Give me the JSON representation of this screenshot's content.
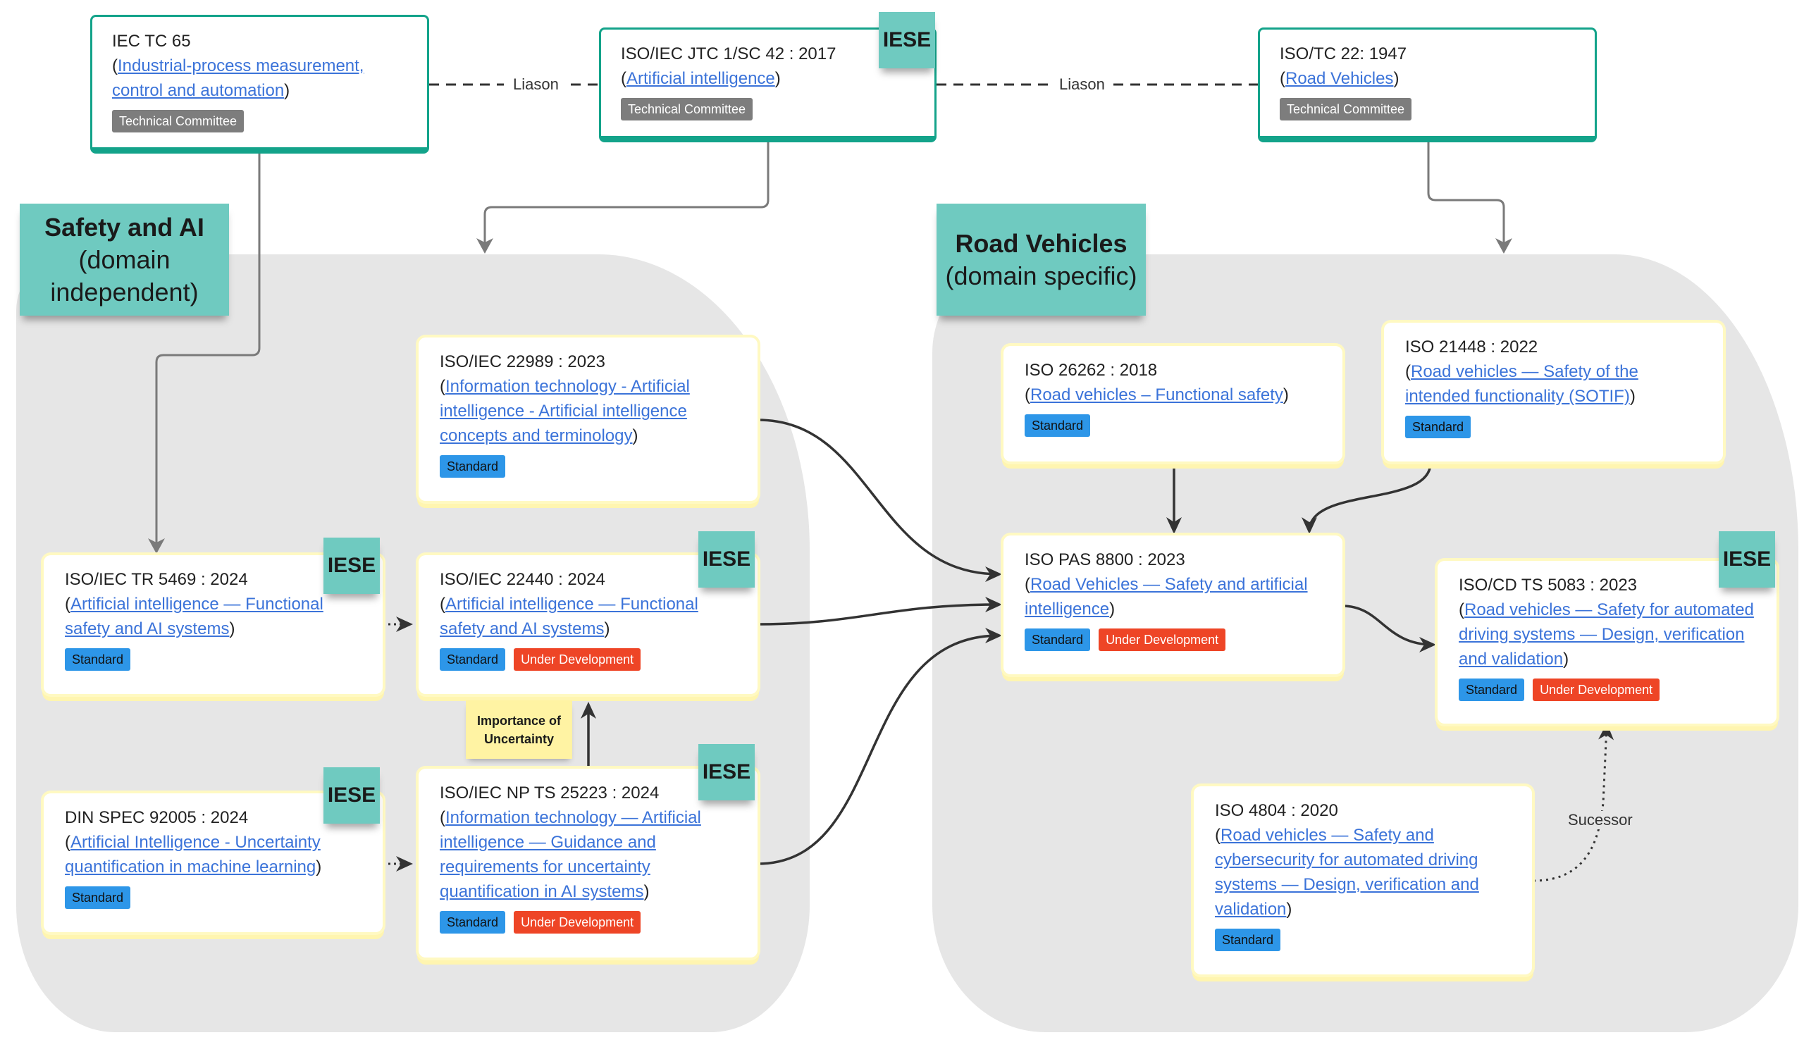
{
  "regions": {
    "left": {
      "title": "Safety and AI",
      "subtitle_line1": "(domain",
      "subtitle_line2": "independent)"
    },
    "right": {
      "title": "Road Vehicles",
      "subtitle": "(domain specific)"
    }
  },
  "committees": [
    {
      "code": "IEC TC 65",
      "title": "Industrial-process measurement, control and automation",
      "badge": "Technical Committee",
      "iese": false
    },
    {
      "code": "ISO/IEC JTC 1/SC 42 : 2017",
      "title": "Artificial intelligence",
      "badge": "Technical Committee",
      "iese": true
    },
    {
      "code": "ISO/TC 22: 1947",
      "title": "Road Vehicles",
      "badge": "Technical Committee",
      "iese": false
    }
  ],
  "standards": {
    "iso_iec_22989": {
      "code": "ISO/IEC 22989 : 2023",
      "title": "Information technology - Artificial intelligence - Artificial intelligence concepts and terminology",
      "badges": [
        "Standard"
      ],
      "iese": false
    },
    "iso_iec_tr_5469": {
      "code": "ISO/IEC TR 5469 : 2024",
      "title": "Artificial intelligence — Functional safety and AI systems",
      "badges": [
        "Standard"
      ],
      "iese": true
    },
    "iso_iec_22440": {
      "code": "ISO/IEC 22440 : 2024",
      "title": "Artificial intelligence — Functional safety and AI systems",
      "badges": [
        "Standard",
        "Under Development"
      ],
      "iese": true
    },
    "din_spec_92005": {
      "code": "DIN SPEC 92005 : 2024",
      "title": "Artificial Intelligence - Uncertainty quantification in machine learning",
      "badges": [
        "Standard"
      ],
      "iese": true
    },
    "iso_iec_np_ts_25223": {
      "code": "ISO/IEC NP TS 25223 : 2024",
      "title": "Information technology — Artificial intelligence — Guidance and requirements for uncertainty quantification in AI systems",
      "badges": [
        "Standard",
        "Under Development"
      ],
      "iese": true
    },
    "iso_26262": {
      "code": "ISO 26262 : 2018",
      "title": "Road vehicles – Functional safety",
      "badges": [
        "Standard"
      ],
      "iese": false
    },
    "iso_21448": {
      "code": "ISO 21448 : 2022",
      "title": "Road vehicles — Safety of the intended functionality (SOTIF)",
      "badges": [
        "Standard"
      ],
      "iese": false
    },
    "iso_pas_8800": {
      "code": "ISO PAS 8800 : 2023",
      "title": "Road Vehicles — Safety and artificial intelligence",
      "badges": [
        "Standard",
        "Under Development"
      ],
      "iese": false
    },
    "iso_cd_ts_5083": {
      "code": "ISO/CD TS 5083 : 2023",
      "title": "Road vehicles — Safety for automated driving systems — Design, verification and validation",
      "badges": [
        "Standard",
        "Under Development"
      ],
      "iese": true
    },
    "iso_4804": {
      "code": "ISO 4804 : 2020",
      "title": "Road vehicles — Safety and cybersecurity for automated driving systems — Design, verification and validation",
      "badges": [
        "Standard"
      ],
      "iese": false
    }
  },
  "labels": {
    "iese": "IESE",
    "liaison_left": "Liason",
    "liaison_right": "Liason",
    "successor": "Sucessor",
    "importance_line1": "Importance of",
    "importance_line2": "Uncertainty",
    "paren_open": "(",
    "paren_close": ")"
  },
  "colors": {
    "committee_border": "#13a38a",
    "sticky_teal": "#6fcac0",
    "standard_badge": "#2d96e8",
    "dev_badge": "#ee4526",
    "tc_badge": "#7d7d7d",
    "link": "#3b73d9",
    "region_bg": "#e6e6e6"
  }
}
